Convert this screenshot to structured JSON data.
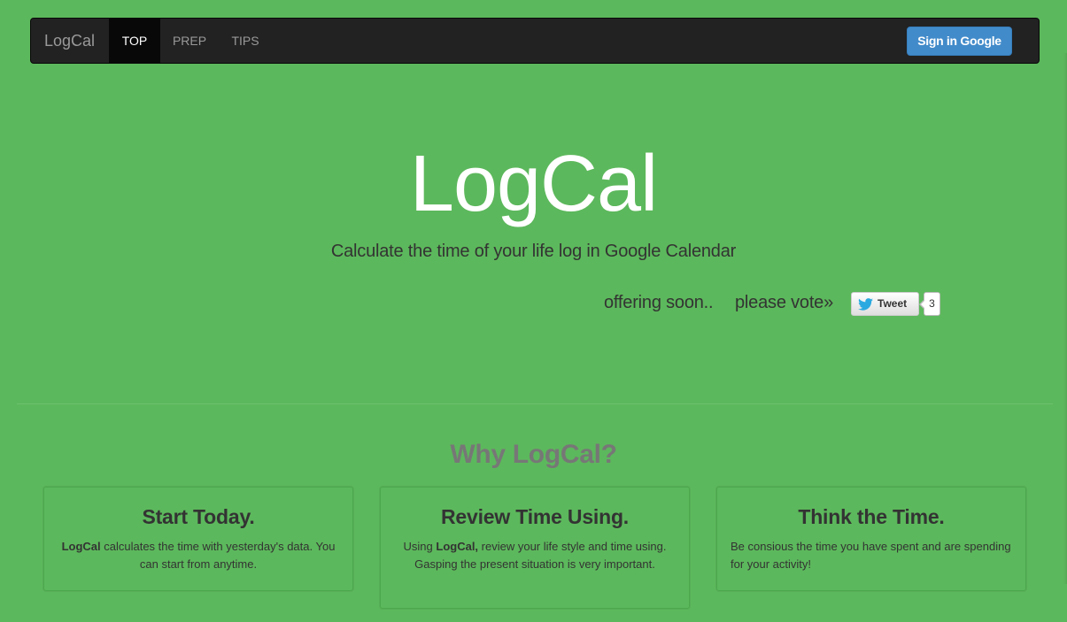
{
  "nav": {
    "brand": "LogCal",
    "items": [
      {
        "label": "TOP",
        "active": true
      },
      {
        "label": "PREP",
        "active": false
      },
      {
        "label": "TIPS",
        "active": false
      }
    ],
    "signin_label": "Sign in Google"
  },
  "hero": {
    "title": "LogCal",
    "subtitle": "Calculate the time of your life log in Google Calendar",
    "offering": "offering soon..",
    "vote": "please vote»",
    "tweet_label": "Tweet",
    "tweet_count": "3"
  },
  "why": {
    "heading": "Why LogCal?",
    "cards": [
      {
        "title": "Start Today.",
        "text_bold": "LogCal",
        "text_rest": " calculates the time with yesterday's data. You can start from anytime."
      },
      {
        "title": "Review Time Using.",
        "text_pre": "Using ",
        "text_bold": "LogCal,",
        "text_rest": " review your life style and time using. Gasping the present situation is very important."
      },
      {
        "title": "Think the Time.",
        "text": "Be consious the time you have spent and are spending for your activity!"
      }
    ]
  },
  "colors": {
    "background": "#5cb85c",
    "navbar": "#222222",
    "primary_button": "#428bca",
    "heading_muted": "#777777"
  }
}
